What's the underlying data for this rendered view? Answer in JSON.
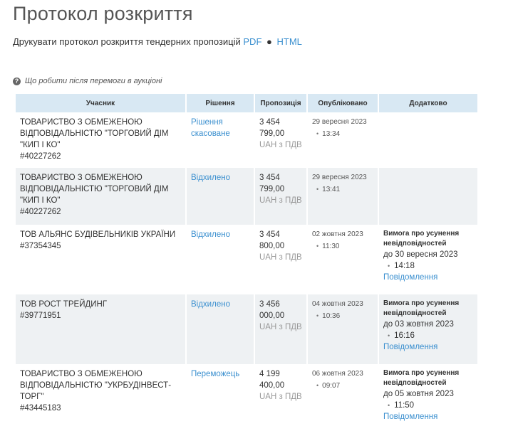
{
  "page": {
    "title": "Протокол розкриття",
    "print_text": "Друкувати протокол розкриття тендерних пропозицій",
    "print_pdf": "PDF",
    "print_separator": "●",
    "print_html": "HTML",
    "help_icon": "question-circle-icon",
    "help_text": "Що робити після перемоги в аукціоні"
  },
  "table": {
    "headers": {
      "participant": "Учасник",
      "decision": "Рішення",
      "offer": "Пропозиція",
      "published": "Опубліковано",
      "extra": "Додатково"
    },
    "rows": [
      {
        "name": "ТОВАРИСТВО З ОБМЕЖЕНОЮ ВІДПОВІДАЛЬНІСТЮ \"ТОРГОВИЙ ДІМ \"КИП І КО\"",
        "id": "#40227262",
        "decision": "Рішення скасоване",
        "amount_1": "3 454",
        "amount_2": "799,00",
        "currency": "UAH з ПДВ",
        "pub_date": "29 вересня 2023",
        "pub_time": "13:34",
        "req_title": "",
        "req_date": "",
        "req_time": "",
        "req_link": ""
      },
      {
        "name": "ТОВАРИСТВО З ОБМЕЖЕНОЮ ВІДПОВІДАЛЬНІСТЮ \"ТОРГОВИЙ ДІМ \"КИП І КО\"",
        "id": "#40227262",
        "decision": "Відхилено",
        "amount_1": "3 454",
        "amount_2": "799,00",
        "currency": "UAH з ПДВ",
        "pub_date": "29 вересня 2023",
        "pub_time": "13:41",
        "req_title": "",
        "req_date": "",
        "req_time": "",
        "req_link": ""
      },
      {
        "name": "ТОВ АЛЬЯНС БУДІВЕЛЬНИКІВ УКРАЇНИ",
        "id": "#37354345",
        "decision": "Відхилено",
        "amount_1": "3 454",
        "amount_2": "800,00",
        "currency": "UAH з ПДВ",
        "pub_date": "02 жовтня 2023",
        "pub_time": "11:30",
        "req_title": "Вимога про усунення невідповідностей",
        "req_date": "до 30 вересня 2023",
        "req_time": "14:18",
        "req_link": "Повідомлення"
      },
      {
        "name": "ТОВ РОСТ ТРЕЙДИНГ",
        "id": "#39771951",
        "decision": "Відхилено",
        "amount_1": "3 456",
        "amount_2": "000,00",
        "currency": "UAH з ПДВ",
        "pub_date": "04 жовтня 2023",
        "pub_time": "10:36",
        "req_title": "Вимога про усунення невідповідностей",
        "req_date": "до 03 жовтня 2023",
        "req_time": "16:16",
        "req_link": "Повідомлення"
      },
      {
        "name": "ТОВАРИСТВО З ОБМЕЖЕНОЮ ВІДПОВІДАЛЬНІСТЮ \"УКРБУДІНВЕСТ-ТОРГ\"",
        "id": "#43445183",
        "decision": "Переможець",
        "amount_1": "4 199",
        "amount_2": "400,00",
        "currency": "UAH з ПДВ",
        "pub_date": "06 жовтня 2023",
        "pub_time": "09:07",
        "req_title": "Вимога про усунення невідповідностей",
        "req_date": "до 05 жовтня 2023",
        "req_time": "11:50",
        "req_link": "Повідомлення"
      }
    ]
  },
  "colors": {
    "link": "#3a8fcf",
    "header_bg": "#d8e8f3",
    "alt_row_bg": "#eef1f3"
  }
}
